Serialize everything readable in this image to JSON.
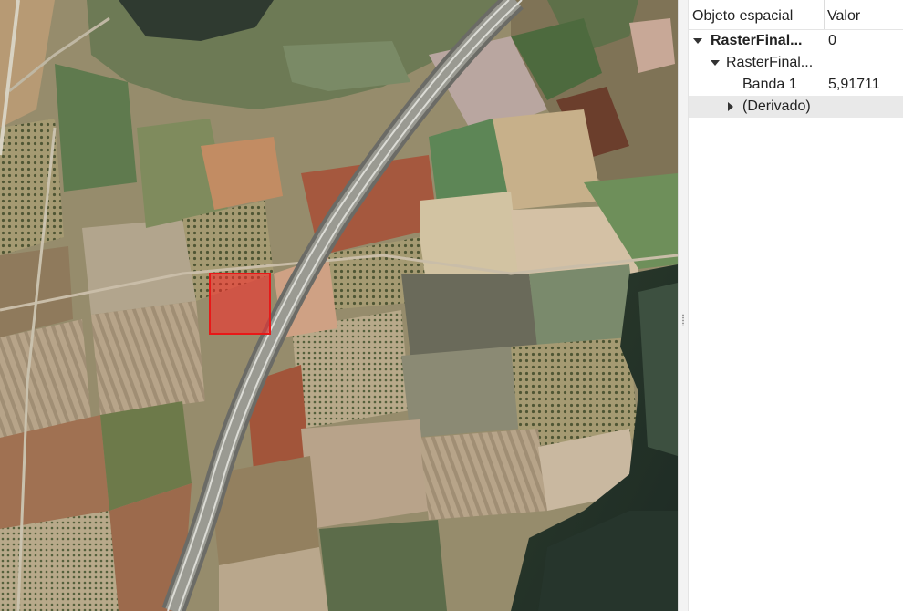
{
  "map": {
    "selection_highlight_color": "#ff2020"
  },
  "panel": {
    "columns": {
      "feature": "Objeto espacial",
      "value": "Valor"
    },
    "rows": [
      {
        "label": "RasterFinal...",
        "value": "0"
      },
      {
        "label": "RasterFinal...",
        "value": ""
      },
      {
        "label": "Banda 1",
        "value": "5,91711"
      },
      {
        "label": "(Derivado)",
        "value": ""
      }
    ]
  }
}
